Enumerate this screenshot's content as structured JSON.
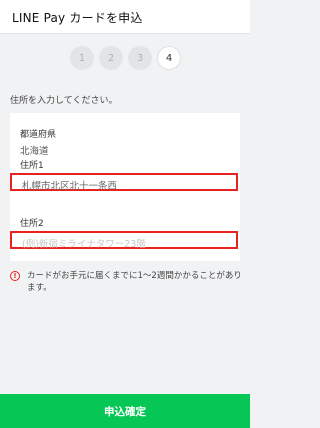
{
  "header": {
    "title": "LINE Pay カードを申込"
  },
  "steps": {
    "items": [
      "1",
      "2",
      "3",
      "4"
    ],
    "current": 4
  },
  "instruction": "住所を入力してください。",
  "form": {
    "prefecture": {
      "label": "都道府県",
      "value": "北海道"
    },
    "address1": {
      "label": "住所1",
      "value": "札幌市北区北十一条西"
    },
    "address2": {
      "label": "住所2",
      "placeholder": "(例)新宿ミライナタワー23階"
    }
  },
  "notice": {
    "icon": "alert-icon",
    "text": "カードがお手元に届くまでに1〜2週間かかることがあります。"
  },
  "submit": {
    "label": "申込確定"
  },
  "colors": {
    "accent": "#06c755",
    "highlight": "#e8231f"
  }
}
